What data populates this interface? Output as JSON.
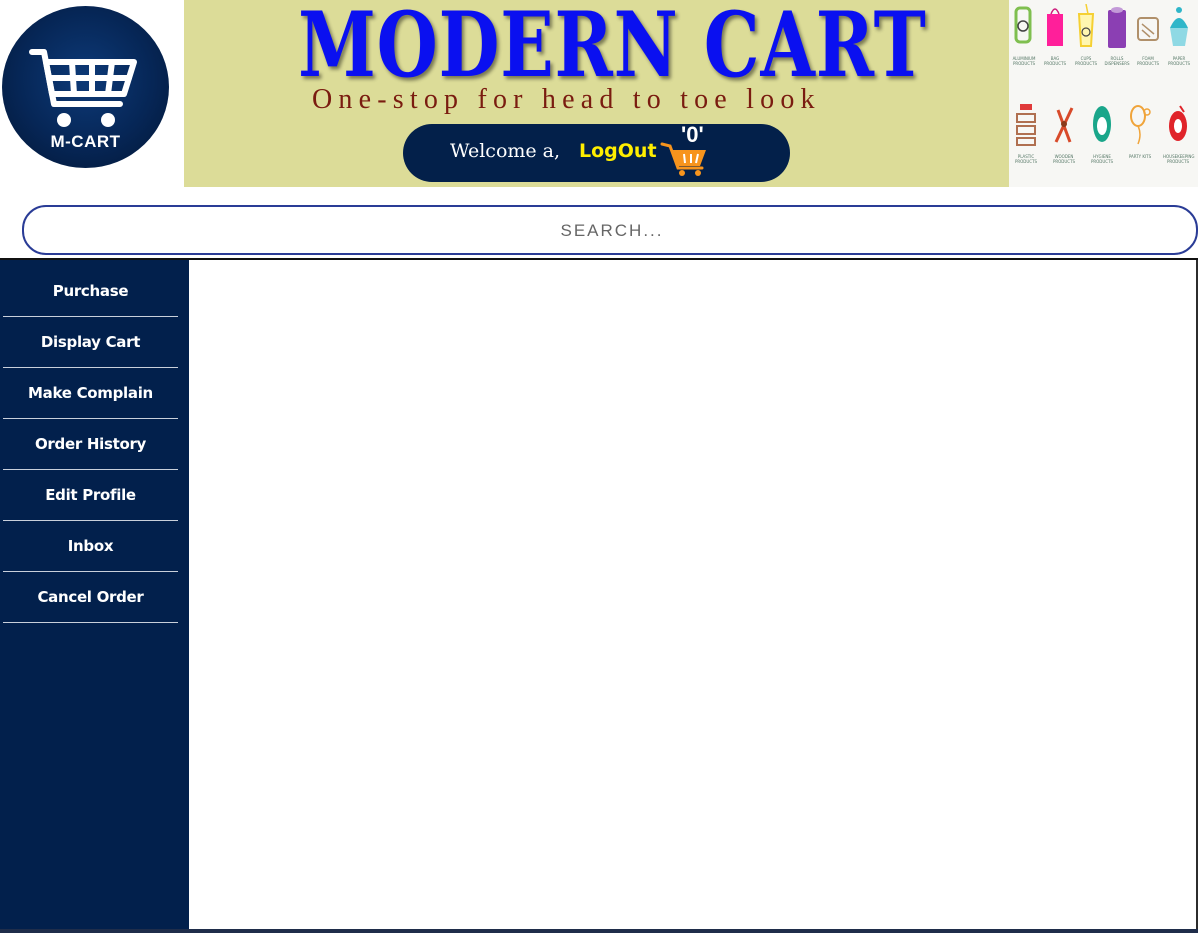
{
  "header": {
    "logo_text": "M-CART",
    "title": "MODERN CART",
    "tagline": "One-stop for head to toe look",
    "welcome_text": "Welcome a,",
    "logout_label": "LogOut",
    "cart_count": "'0'",
    "categories": [
      {
        "label": "Aluminium Products",
        "icon": "roll-icon",
        "color": "#7fbf4f"
      },
      {
        "label": "Bag Products",
        "icon": "bag-icon",
        "color": "#ff1f9a"
      },
      {
        "label": "Cups Products",
        "icon": "cup-icon",
        "color": "#f5d033"
      },
      {
        "label": "Rolls Dispensers",
        "icon": "tissue-icon",
        "color": "#8b3fb3"
      },
      {
        "label": "Foam Products",
        "icon": "foam-icon",
        "color": "#b0906a"
      },
      {
        "label": "Paper Products",
        "icon": "cupcake-icon",
        "color": "#2fb6c9"
      },
      {
        "label": "Plastic Products",
        "icon": "container-icon",
        "color": "#e03a3a"
      },
      {
        "label": "Wooden Products",
        "icon": "cutlery-icon",
        "color": "#d84a2a"
      },
      {
        "label": "Hygiene Products",
        "icon": "mask-icon",
        "color": "#1aa68a"
      },
      {
        "label": "Party Kits",
        "icon": "balloon-icon",
        "color": "#f0a43a"
      },
      {
        "label": "Housekeeping Products",
        "icon": "tape-icon",
        "color": "#e0242a"
      }
    ]
  },
  "search": {
    "placeholder": "SEARCH..."
  },
  "sidebar": {
    "items": [
      {
        "label": "Purchase"
      },
      {
        "label": "Display Cart"
      },
      {
        "label": "Make Complain"
      },
      {
        "label": "Order History"
      },
      {
        "label": "Edit Profile"
      },
      {
        "label": "Inbox"
      },
      {
        "label": "Cancel Order"
      }
    ]
  },
  "colors": {
    "navy": "#02204c",
    "banner_bg": "#dcdc98",
    "title_blue": "#0a10f0",
    "logout_yellow": "#ffee00",
    "cart_orange": "#f7941d"
  }
}
